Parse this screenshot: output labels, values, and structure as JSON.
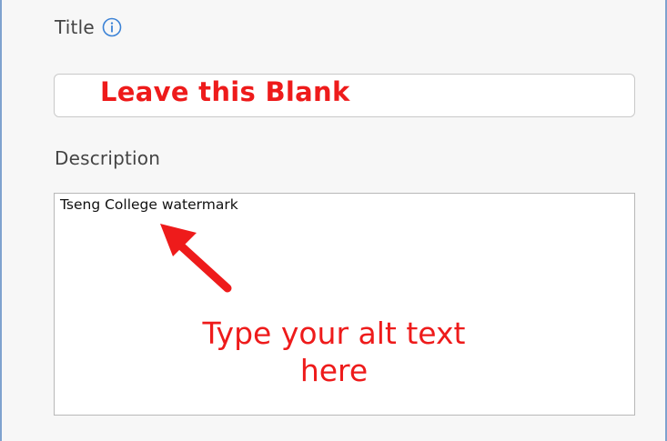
{
  "title_field": {
    "label": "Title",
    "icon": "info-icon",
    "value": "",
    "annotation": "Leave this Blank"
  },
  "description_field": {
    "label": "Description",
    "value": "Tseng College watermark",
    "annotation_line1": "Type your alt text",
    "annotation_line2": "here"
  },
  "colors": {
    "annotation": "#ee1b1b",
    "info_icon": "#3b82d6",
    "panel_border": "#7fa3cf"
  }
}
